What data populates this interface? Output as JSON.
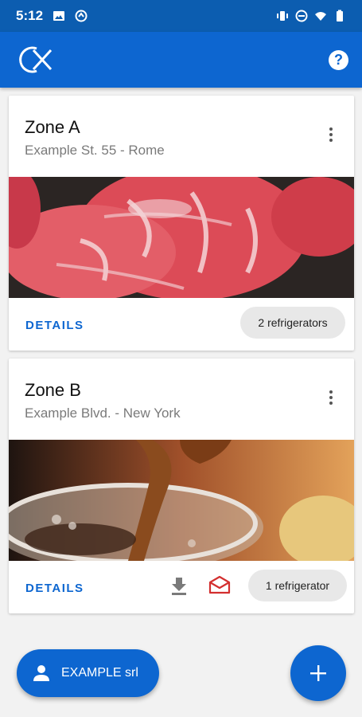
{
  "status_bar": {
    "time": "5:12"
  },
  "app_bar": {
    "help_label": "?"
  },
  "zones": [
    {
      "title": "Zone A",
      "address": "Example St. 55 - Rome",
      "details_label": "DETAILS",
      "count_label": "2 refrigerators",
      "image": "meat-photo"
    },
    {
      "title": "Zone B",
      "address": "Example Blvd. - New York",
      "details_label": "DETAILS",
      "count_label": "1 refrigerator",
      "image": "drink-pour-photo"
    }
  ],
  "user_fab": {
    "label": "EXAMPLE srl"
  },
  "colors": {
    "primary": "#0d66d0",
    "status_bar": "#0c5db0",
    "mail_icon": "#d32f2f",
    "chip_bg": "#e8e8e8"
  }
}
